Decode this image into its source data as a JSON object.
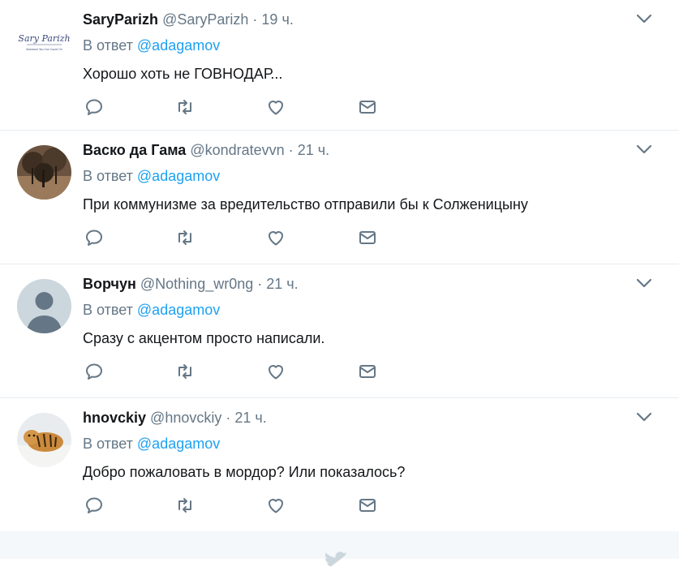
{
  "tweets": [
    {
      "fullname": "SaryParizh",
      "username": "@SaryParizh",
      "sep": "·",
      "time": "19 ч.",
      "reply_prefix": "В ответ",
      "reply_mention": "@adagamov",
      "text": "Хорошо хоть не ГОВНОДАР...",
      "avatar_logo_text": "Sary Parizh",
      "avatar_logo_sub": "Someone You Can Count On"
    },
    {
      "fullname": "Васко да Гама",
      "username": "@kondratevvn",
      "sep": "·",
      "time": "21 ч.",
      "reply_prefix": "В ответ",
      "reply_mention": "@adagamov",
      "text": "При коммунизме за вредительство отправили бы к Солженицыну"
    },
    {
      "fullname": "Ворчун",
      "username": "@Nothing_wr0ng",
      "sep": "·",
      "time": "21 ч.",
      "reply_prefix": "В ответ",
      "reply_mention": "@adagamov",
      "text": "Сразу с акцентом просто написали."
    },
    {
      "fullname": "hnovckiy",
      "username": "@hnovckiy",
      "sep": "·",
      "time": "21 ч.",
      "reply_prefix": "В ответ",
      "reply_mention": "@adagamov",
      "text": "Добро пожаловать в мордор? Или показалось?"
    }
  ],
  "colors": {
    "accent": "#1da1f2",
    "muted": "#657786",
    "divider": "#e6ecf0",
    "footer_bg": "#f5f8fa"
  },
  "icons": [
    "reply-icon",
    "retweet-icon",
    "like-icon",
    "message-icon",
    "chevron-down-icon",
    "bird-icon"
  ]
}
